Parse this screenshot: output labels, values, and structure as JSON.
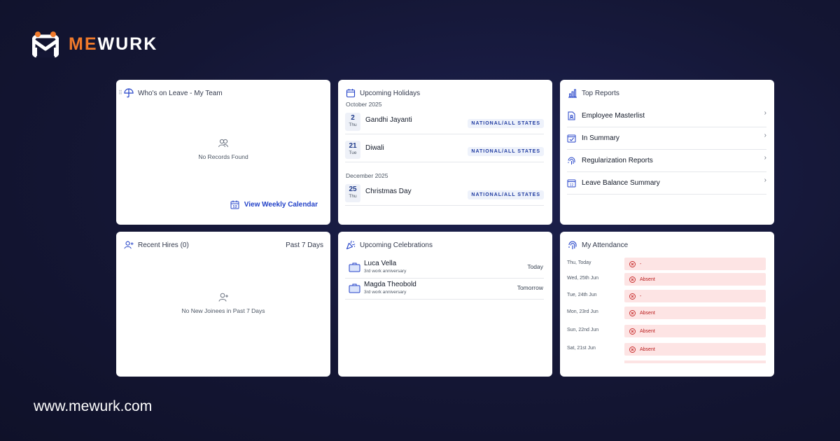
{
  "brand": {
    "name_prefix": "ME",
    "name_suffix": "WURK",
    "url": "www.mewurk.com",
    "accent": "#f07a2b",
    "link_color": "#2342c8"
  },
  "leave_card": {
    "title": "Who's on Leave - My Team",
    "empty_text": "No Records Found",
    "link_label": "View Weekly Calendar",
    "icon": "umbrella-icon"
  },
  "holidays_card": {
    "title": "Upcoming Holidays",
    "months": [
      {
        "label": "October 2025",
        "items": [
          {
            "day": "2",
            "weekday": "Thu",
            "name": "Gandhi Jayanti",
            "tag": "NATIONAL/ALL STATES"
          },
          {
            "day": "21",
            "weekday": "Tue",
            "name": "Diwali",
            "tag": "NATIONAL/ALL STATES"
          }
        ]
      },
      {
        "label": "December 2025",
        "items": [
          {
            "day": "25",
            "weekday": "Thu",
            "name": "Christmas Day",
            "tag": "NATIONAL/ALL STATES"
          }
        ]
      }
    ]
  },
  "reports_card": {
    "title": "Top Reports",
    "items": [
      {
        "label": "Employee Masterlist",
        "icon": "document-icon"
      },
      {
        "label": "In Summary",
        "icon": "calendar-check-icon"
      },
      {
        "label": "Regularization Reports",
        "icon": "fingerprint-icon"
      },
      {
        "label": "Leave Balance Summary",
        "icon": "calendar-icon"
      }
    ]
  },
  "hires_card": {
    "title": "Recent Hires (0)",
    "range": "Past 7 Days",
    "empty_text": "No New Joinees in Past 7 Days"
  },
  "celebrations_card": {
    "title": "Upcoming Celebrations",
    "items": [
      {
        "name": "Luca Vella",
        "occasion": "3rd work anniversary",
        "when": "Today"
      },
      {
        "name": "Magda Theobold",
        "occasion": "3rd work anniversary",
        "when": "Tomorrow"
      }
    ]
  },
  "attendance_card": {
    "title": "My Attendance",
    "items": [
      {
        "day": "Thu, Today",
        "status": "-"
      },
      {
        "day": "Wed, 25th Jun",
        "status": "Absent"
      },
      {
        "day": "Tue, 24th Jun",
        "status": "-"
      },
      {
        "day": "Mon, 23rd Jun",
        "status": "Absent"
      },
      {
        "day": "Sun, 22nd Jun",
        "status": "Absent"
      },
      {
        "day": "Sat, 21st Jun",
        "status": "Absent"
      }
    ]
  }
}
